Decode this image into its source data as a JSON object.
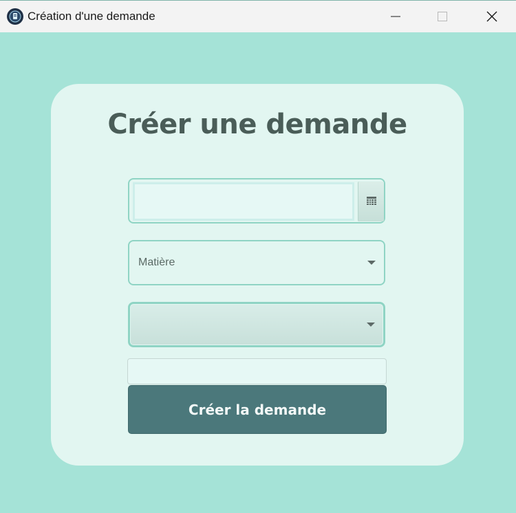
{
  "window": {
    "title": "Création d'une demande",
    "icons": {
      "app": "app-logo-icon",
      "minimize": "minimize-icon",
      "maximize": "maximize-icon",
      "close": "close-icon"
    }
  },
  "form": {
    "title": "Créer une demande",
    "date_field": {
      "value": "",
      "icon": "calendar-icon"
    },
    "subject_select": {
      "placeholder": "Matière",
      "icon": "chevron-down-icon"
    },
    "level_select": {
      "value": "",
      "icon": "chevron-down-icon"
    },
    "description_field": {
      "value": ""
    },
    "submit_label": "Créer la demande"
  },
  "colors": {
    "background": "#a5e3d7",
    "card": "#e2f6f1",
    "title_text": "#4a5d58",
    "button": "#4b787b",
    "border": "#8fd4c4"
  }
}
